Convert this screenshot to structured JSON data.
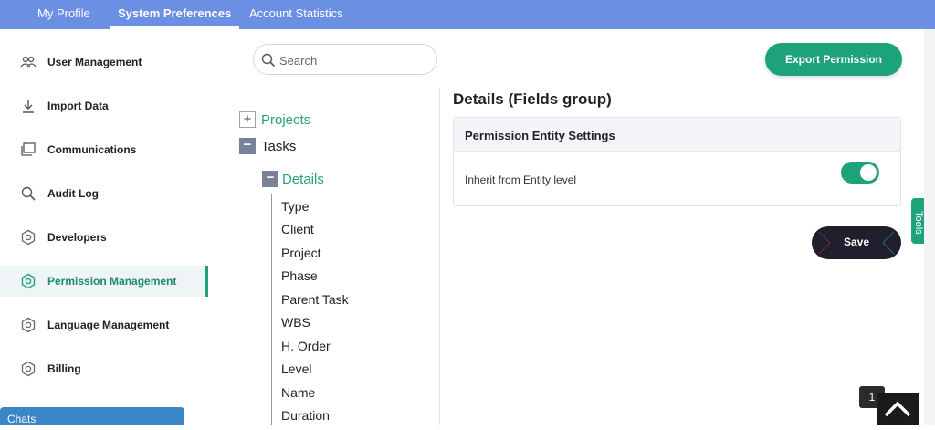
{
  "header": {
    "tabs": [
      {
        "label": "My Profile"
      },
      {
        "label": "System Preferences"
      },
      {
        "label": "Account Statistics"
      }
    ],
    "active_tab": "System Preferences"
  },
  "sidebar": {
    "items": [
      {
        "label": "User Management",
        "icon": "users-icon"
      },
      {
        "label": "Import Data",
        "icon": "download-icon"
      },
      {
        "label": "Communications",
        "icon": "chat-window-icon"
      },
      {
        "label": "Audit Log",
        "icon": "search-icon"
      },
      {
        "label": "Developers",
        "icon": "hexagon-gear-icon"
      },
      {
        "label": "Permission Management",
        "icon": "hexagon-gear-icon"
      },
      {
        "label": "Language Management",
        "icon": "hexagon-gear-icon"
      },
      {
        "label": "Billing",
        "icon": "hexagon-gear-icon"
      }
    ],
    "active_item": "Permission Management"
  },
  "chats": {
    "label": "Chats"
  },
  "search": {
    "placeholder": "Search"
  },
  "tree": {
    "nodes": [
      {
        "label": "Projects",
        "toggle": "+"
      },
      {
        "label": "Tasks",
        "toggle": "−"
      },
      {
        "label": "Details",
        "toggle": "−"
      }
    ],
    "details_children": [
      "Type",
      "Client",
      "Project",
      "Phase",
      "Parent Task",
      "WBS",
      "H. Order",
      "Level",
      "Name",
      "Duration"
    ]
  },
  "toolbar": {
    "export_label": "Export Permission",
    "save_label": "Save"
  },
  "details": {
    "title": "Details (Fields group)",
    "card_title": "Permission Entity Settings",
    "inherit_label": "Inherit from Entity level",
    "inherit_enabled": true
  },
  "tools": {
    "label": "Tools"
  },
  "notification": {
    "count": "1"
  },
  "colors": {
    "accent": "#1ea27a",
    "header": "#6b8fe3",
    "chats": "#3b86c6"
  }
}
